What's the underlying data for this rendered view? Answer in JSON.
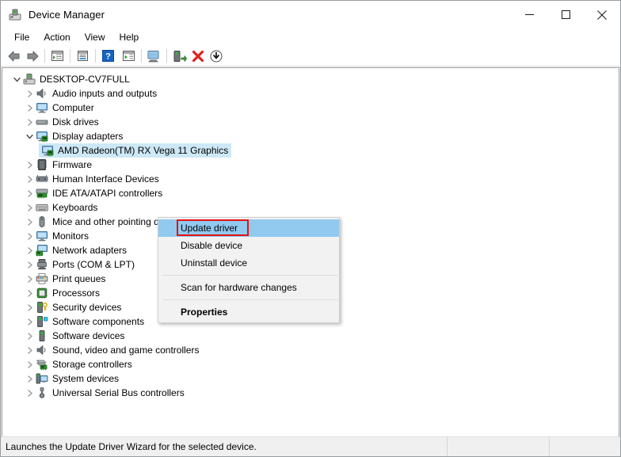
{
  "window": {
    "title": "Device Manager",
    "icon": "device-manager-icon",
    "caption_buttons": [
      {
        "name": "minimize",
        "glyph": "minimize-icon"
      },
      {
        "name": "maximize",
        "glyph": "maximize-icon"
      },
      {
        "name": "close",
        "glyph": "close-icon"
      }
    ]
  },
  "menubar": {
    "items": [
      {
        "label": "File"
      },
      {
        "label": "Action"
      },
      {
        "label": "View"
      },
      {
        "label": "Help"
      }
    ]
  },
  "toolbar": {
    "buttons": [
      {
        "name": "back-icon"
      },
      {
        "name": "forward-icon"
      },
      {
        "name": "show-hide-console-tree-icon"
      },
      {
        "name": "properties-icon"
      },
      {
        "name": "help-icon"
      },
      {
        "name": "show-hide-action-pane-icon"
      },
      {
        "name": "scan-for-hardware-changes-icon"
      },
      {
        "name": "update-driver-icon"
      },
      {
        "name": "uninstall-device-icon"
      },
      {
        "name": "disable-device-icon"
      }
    ]
  },
  "tree": {
    "root": {
      "label": "DESKTOP-CV7FULL",
      "icon": "computer-root-icon",
      "expanded": true
    },
    "items": [
      {
        "label": "Audio inputs and outputs",
        "icon": "speaker-icon",
        "level": 1,
        "expanded": false
      },
      {
        "label": "Computer",
        "icon": "monitor-icon",
        "level": 1,
        "expanded": false
      },
      {
        "label": "Disk drives",
        "icon": "disk-drive-icon",
        "level": 1,
        "expanded": false
      },
      {
        "label": "Display adapters",
        "icon": "display-adapter-icon",
        "level": 1,
        "expanded": true
      },
      {
        "label": "AMD Radeon(TM) RX Vega 11 Graphics",
        "icon": "display-adapter-icon",
        "level": 2,
        "selected": true
      },
      {
        "label": "Firmware",
        "icon": "firmware-icon",
        "level": 1,
        "expanded": false
      },
      {
        "label": "Human Interface Devices",
        "icon": "hid-icon",
        "level": 1,
        "expanded": false
      },
      {
        "label": "IDE ATA/ATAPI controllers",
        "icon": "ide-controller-icon",
        "level": 1,
        "expanded": false
      },
      {
        "label": "Keyboards",
        "icon": "keyboard-icon",
        "level": 1,
        "expanded": false
      },
      {
        "label": "Mice and other pointing devices",
        "icon": "mouse-icon",
        "level": 1,
        "expanded": false
      },
      {
        "label": "Monitors",
        "icon": "monitor-icon",
        "level": 1,
        "expanded": false
      },
      {
        "label": "Network adapters",
        "icon": "network-adapter-icon",
        "level": 1,
        "expanded": false
      },
      {
        "label": "Ports (COM & LPT)",
        "icon": "port-icon",
        "level": 1,
        "expanded": false
      },
      {
        "label": "Print queues",
        "icon": "printer-icon",
        "level": 1,
        "expanded": false
      },
      {
        "label": "Processors",
        "icon": "processor-icon",
        "level": 1,
        "expanded": false
      },
      {
        "label": "Security devices",
        "icon": "security-device-icon",
        "level": 1,
        "expanded": false
      },
      {
        "label": "Software components",
        "icon": "software-component-icon",
        "level": 1,
        "expanded": false
      },
      {
        "label": "Software devices",
        "icon": "software-device-icon",
        "level": 1,
        "expanded": false
      },
      {
        "label": "Sound, video and game controllers",
        "icon": "speaker-icon",
        "level": 1,
        "expanded": false
      },
      {
        "label": "Storage controllers",
        "icon": "storage-controller-icon",
        "level": 1,
        "expanded": false
      },
      {
        "label": "System devices",
        "icon": "system-device-icon",
        "level": 1,
        "expanded": false
      },
      {
        "label": "Universal Serial Bus controllers",
        "icon": "usb-controller-icon",
        "level": 1,
        "expanded": false
      }
    ]
  },
  "context_menu": {
    "items": [
      {
        "label": "Update driver",
        "highlight": true,
        "bold": false,
        "annotated": true
      },
      {
        "label": "Disable device",
        "highlight": false,
        "bold": false
      },
      {
        "label": "Uninstall device",
        "highlight": false,
        "bold": false
      },
      {
        "separator": true
      },
      {
        "label": "Scan for hardware changes",
        "highlight": false,
        "bold": false
      },
      {
        "separator": true
      },
      {
        "label": "Properties",
        "highlight": false,
        "bold": true
      }
    ]
  },
  "statusbar": {
    "message": "Launches the Update Driver Wizard for the selected device."
  },
  "colors": {
    "selection_blue": "#cde8f6",
    "menu_highlight_blue": "#91c9ef",
    "annotation_red": "#e81010",
    "window_bg": "#f0f0f0"
  }
}
